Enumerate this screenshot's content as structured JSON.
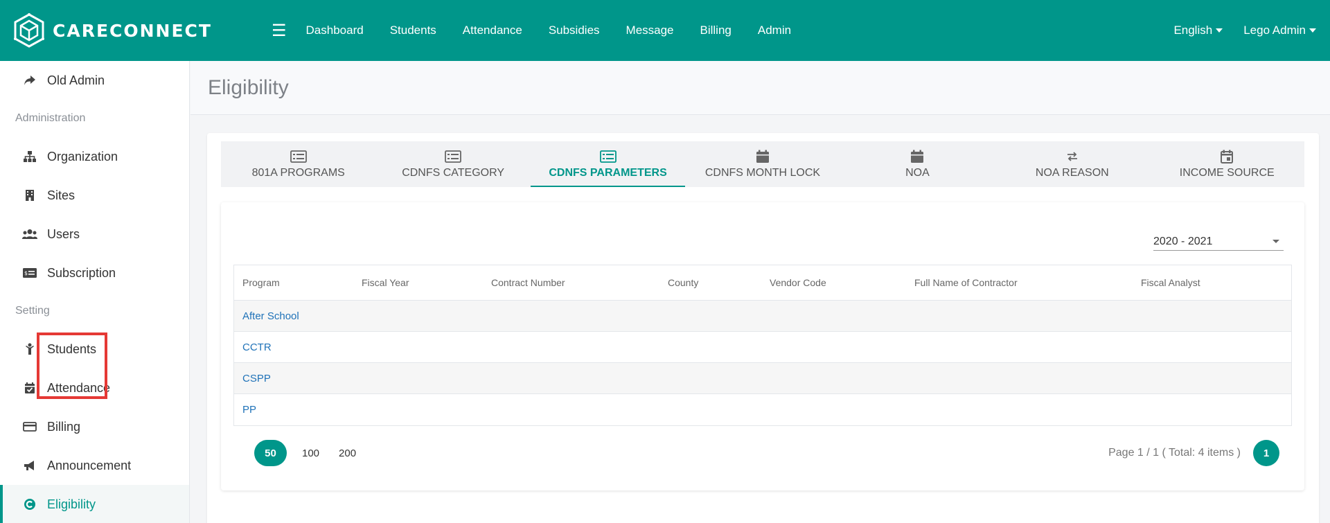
{
  "brand": {
    "name": "CARECONNECT"
  },
  "nav": [
    "Dashboard",
    "Students",
    "Attendance",
    "Subsidies",
    "Message",
    "Billing",
    "Admin"
  ],
  "top_right": {
    "language": "English",
    "user": "Lego Admin"
  },
  "sidebar": {
    "old_admin": "Old Admin",
    "section_administration": "Administration",
    "administration_items": [
      "Organization",
      "Sites",
      "Users",
      "Subscription"
    ],
    "section_setting": "Setting",
    "setting_items": [
      "Students",
      "Attendance",
      "Billing",
      "Announcement",
      "Eligibility"
    ],
    "active_item": "Eligibility"
  },
  "page": {
    "title": "Eligibility"
  },
  "tabs": [
    "801A PROGRAMS",
    "CDNFS CATEGORY",
    "CDNFS PARAMETERS",
    "CDNFS MONTH LOCK",
    "NOA",
    "NOA REASON",
    "INCOME SOURCE"
  ],
  "active_tab": "CDNFS PARAMETERS",
  "fiscal_year_select": {
    "value": "2020 - 2021"
  },
  "table": {
    "columns": [
      "Program",
      "Fiscal Year",
      "Contract Number",
      "County",
      "Vendor Code",
      "Full Name of Contractor",
      "Fiscal Analyst"
    ],
    "rows": [
      "After School",
      "CCTR",
      "CSPP",
      "PP"
    ]
  },
  "pagination": {
    "page_sizes": [
      "50",
      "100",
      "200"
    ],
    "active_page_size": "50",
    "summary": "Page 1 / 1 ( Total: 4 items )",
    "current_page": "1"
  },
  "colors": {
    "primary": "#00968a",
    "link": "#1f72b8",
    "highlight": "#e53935"
  }
}
